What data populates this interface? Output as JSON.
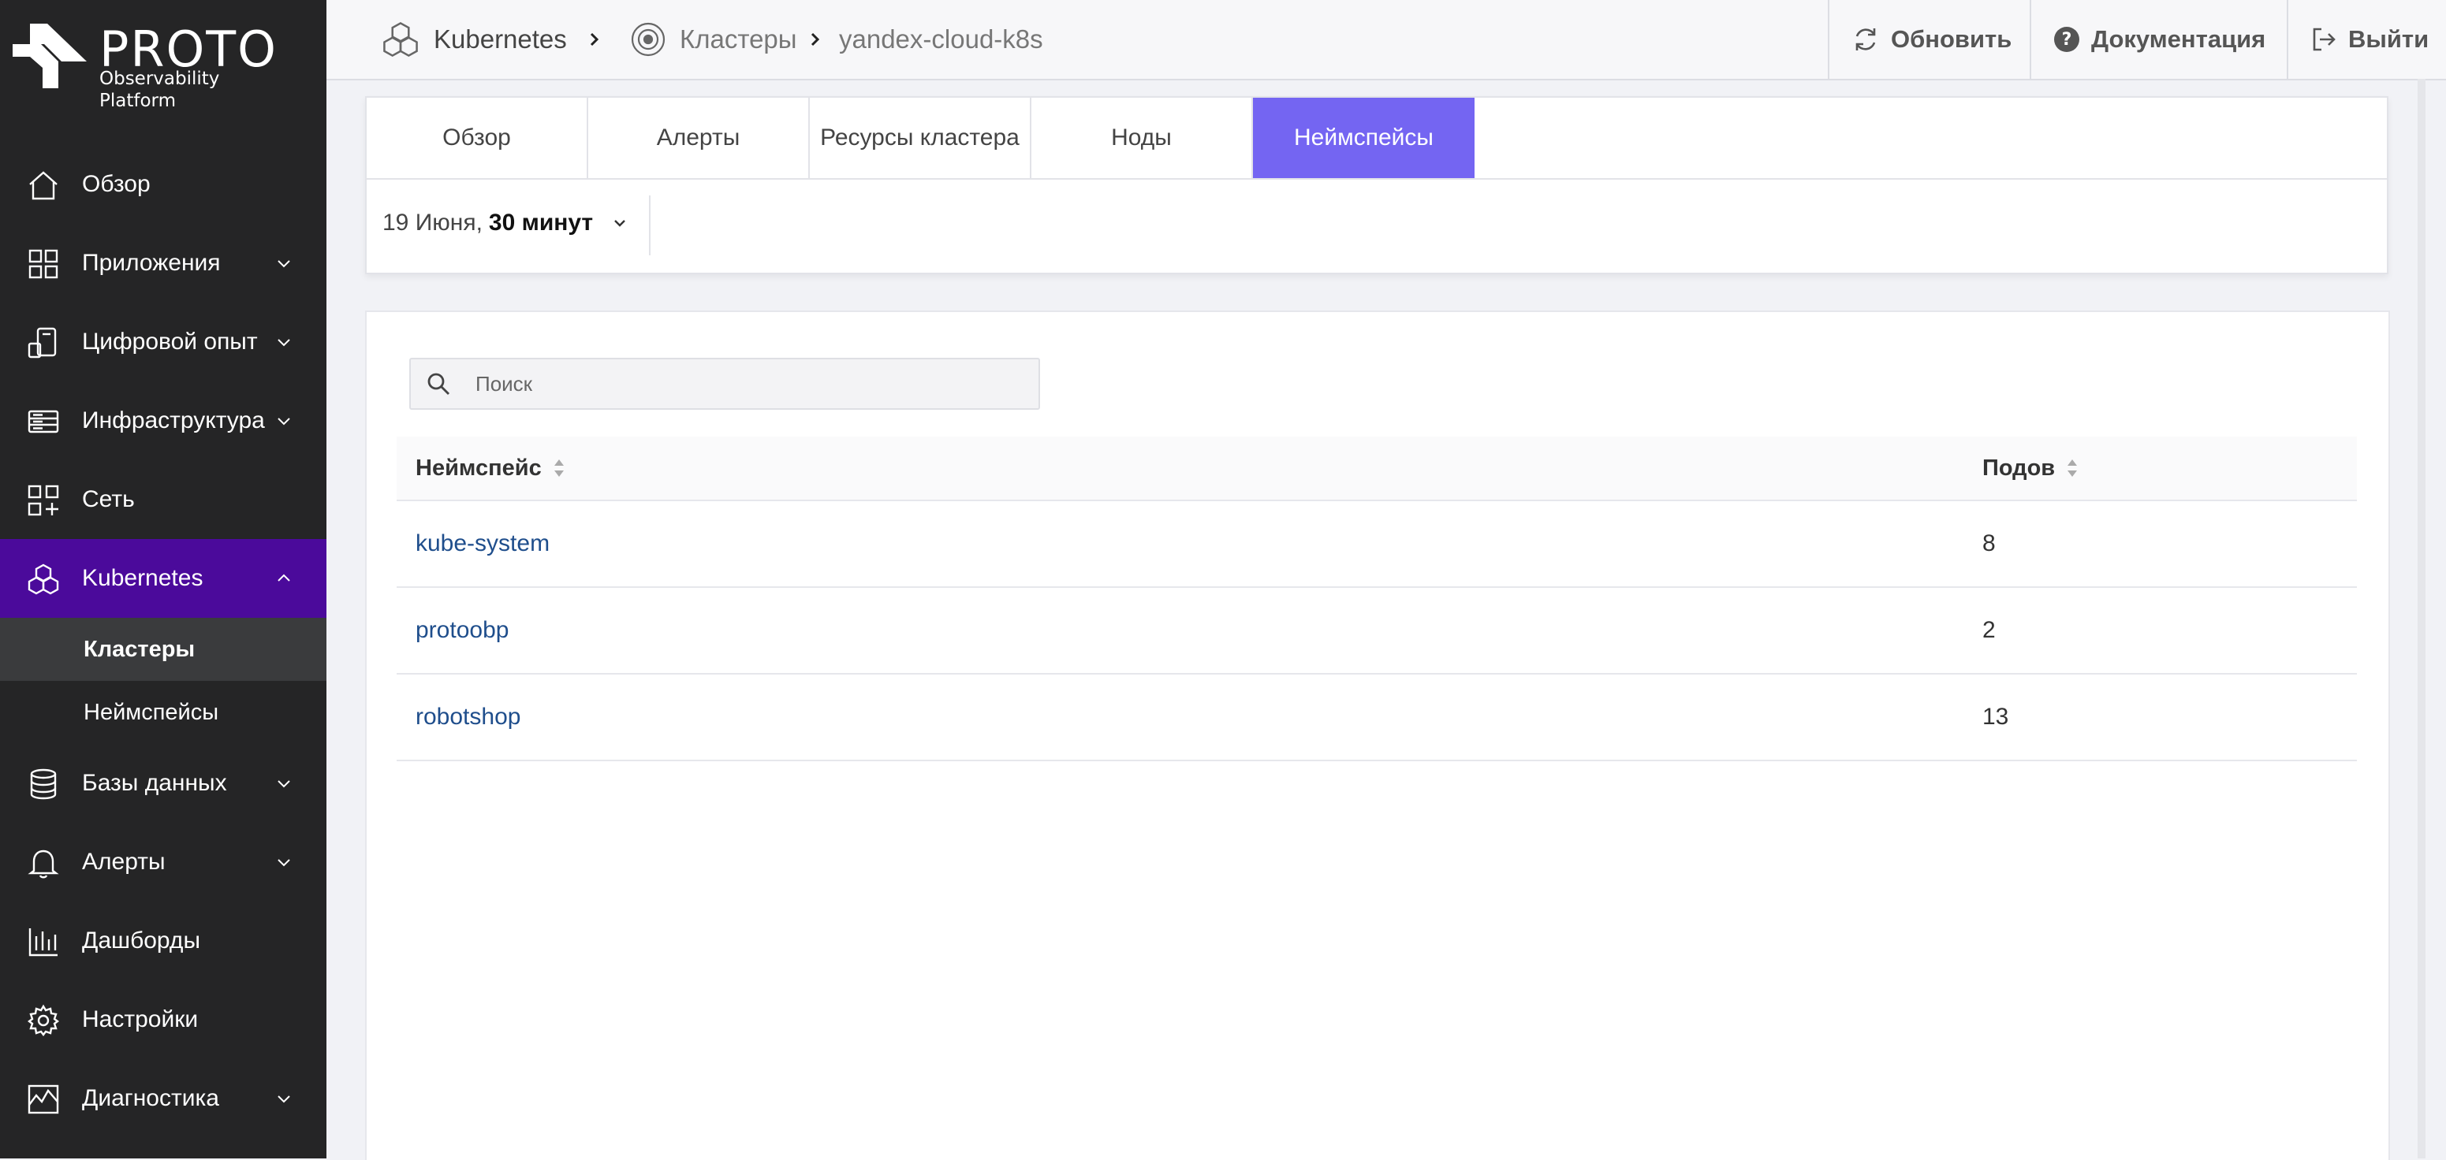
{
  "brand": {
    "name": "PROTO",
    "subtitle": "Observability Platform"
  },
  "sidebar": {
    "items": [
      {
        "label": "Обзор",
        "icon": "home-icon",
        "has_children": false
      },
      {
        "label": "Приложения",
        "icon": "grid-icon",
        "has_children": true
      },
      {
        "label": "Цифровой опыт",
        "icon": "devices-icon",
        "has_children": true
      },
      {
        "label": "Инфраструктура",
        "icon": "server-icon",
        "has_children": true
      },
      {
        "label": "Сеть",
        "icon": "network-icon",
        "has_children": false
      },
      {
        "label": "Kubernetes",
        "icon": "kubernetes-icon",
        "has_children": true,
        "expanded": true,
        "children": [
          {
            "label": "Кластеры",
            "selected": true
          },
          {
            "label": "Неймспейсы",
            "selected": false
          }
        ]
      },
      {
        "label": "Базы данных",
        "icon": "database-icon",
        "has_children": true
      },
      {
        "label": "Алерты",
        "icon": "bell-icon",
        "has_children": true
      },
      {
        "label": "Дашборды",
        "icon": "bar-chart-icon",
        "has_children": false
      },
      {
        "label": "Настройки",
        "icon": "gear-icon",
        "has_children": false
      },
      {
        "label": "Диагностика",
        "icon": "pulse-icon",
        "has_children": true
      }
    ]
  },
  "header": {
    "breadcrumbs": [
      "Kubernetes",
      "Кластеры",
      "yandex-cloud-k8s"
    ],
    "refresh_label": "Обновить",
    "docs_label": "Документация",
    "logout_label": "Выйти"
  },
  "tabs": [
    {
      "label": "Обзор",
      "active": false
    },
    {
      "label": "Алерты",
      "active": false
    },
    {
      "label": "Ресурсы кластера",
      "active": false
    },
    {
      "label": "Ноды",
      "active": false
    },
    {
      "label": "Неймспейсы",
      "active": true
    }
  ],
  "time_range": {
    "date": "19 Июня,",
    "duration": "30 минут"
  },
  "search": {
    "placeholder": "Поиск",
    "value": ""
  },
  "table": {
    "columns": [
      "Неймспейс",
      "Подов"
    ],
    "rows": [
      {
        "namespace": "kube-system",
        "pods": "8"
      },
      {
        "namespace": "protoobp",
        "pods": "2"
      },
      {
        "namespace": "robotshop",
        "pods": "13"
      }
    ]
  },
  "colors": {
    "sidebar_bg": "#252526",
    "active_nav": "#4b0a9b",
    "active_tab": "#7465f2",
    "link": "#1f4e8c"
  }
}
